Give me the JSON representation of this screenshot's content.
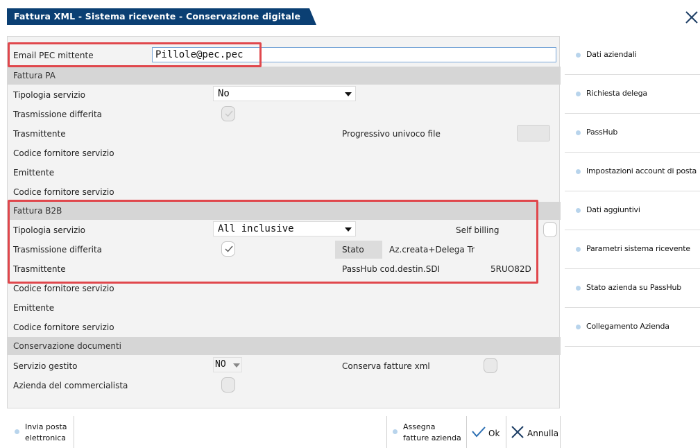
{
  "window": {
    "title": "Fattura XML - Sistema ricevente - Conservazione digitale",
    "close_icon": "close-icon"
  },
  "form": {
    "email_pec_label": "Email PEC mittente",
    "email_pec_value": "Pillole@pec.pec",
    "fattura_pa": {
      "section_label": "Fattura PA",
      "tipologia_servizio_label": "Tipologia servizio",
      "tipologia_servizio_value": "No",
      "trasmissione_differita_label": "Trasmissione differita",
      "trasmittente_label": "Trasmittente",
      "progressivo_label": "Progressivo univoco file",
      "codice_fornitore_1_label": "Codice fornitore servizio",
      "emittente_label": "Emittente",
      "codice_fornitore_2_label": "Codice fornitore servizio"
    },
    "fattura_b2b": {
      "section_label": "Fattura B2B",
      "tipologia_servizio_label": "Tipologia servizio",
      "tipologia_servizio_value": "All inclusive",
      "self_billing_label": "Self billing",
      "trasmissione_differita_label": "Trasmissione differita",
      "stato_label": "Stato",
      "stato_value": "Az.creata+Delega Tr",
      "trasmittente_label": "Trasmittente",
      "passhub_label": "PassHub cod.destin.SDI",
      "passhub_value": "5RUO82D",
      "codice_fornitore_1_label": "Codice fornitore servizio",
      "emittente_label": "Emittente",
      "codice_fornitore_2_label": "Codice fornitore servizio"
    },
    "conservazione": {
      "section_label": "Conservazione documenti",
      "servizio_gestito_label": "Servizio gestito",
      "servizio_gestito_value": "NO",
      "conserva_fatture_label": "Conserva fatture xml",
      "azienda_commercialista_label": "Azienda del commercialista"
    }
  },
  "side_menu": [
    {
      "label": "Dati aziendali"
    },
    {
      "label": "Richiesta delega"
    },
    {
      "label": "PassHub"
    },
    {
      "label": "Impostazioni account di posta"
    },
    {
      "label": "Dati aggiuntivi"
    },
    {
      "label": "Parametri sistema ricevente"
    },
    {
      "label": "Stato azienda su PassHub"
    },
    {
      "label": "Collegamento Azienda"
    }
  ],
  "bottom_bar": {
    "invia_posta_line1": "Invia posta",
    "invia_posta_line2": "elettronica",
    "assegna_line1": "Assegna",
    "assegna_line2": "fatture azienda",
    "ok_label": "Ok",
    "annulla_label": "Annulla"
  },
  "colors": {
    "title_bg": "#0b3f73",
    "highlight_red": "#e0474c",
    "section_bg": "#d6d6d6",
    "menu_dot": "#b8d4ec",
    "check_blue": "#2c6fb3"
  }
}
